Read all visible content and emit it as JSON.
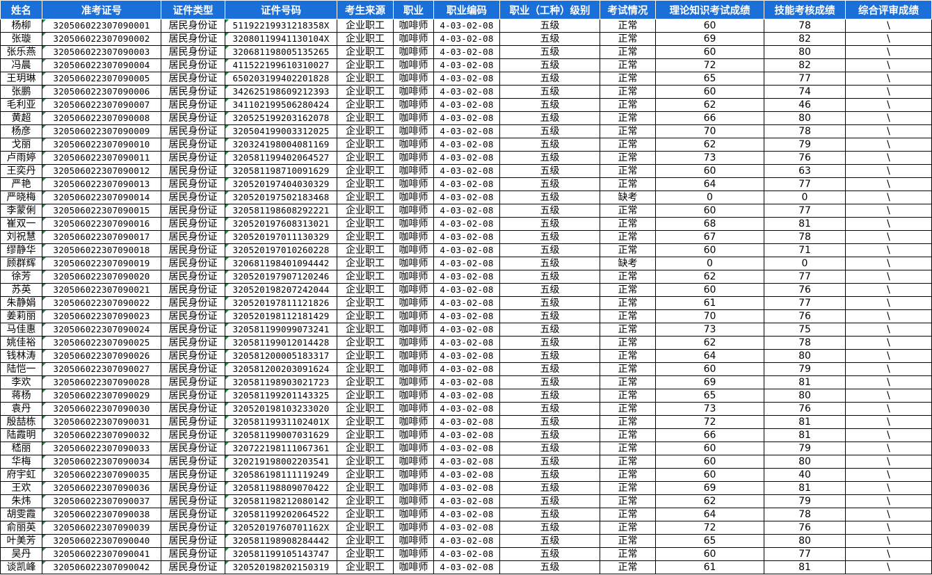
{
  "headers": [
    "姓名",
    "准考证号",
    "证件类型",
    "证件号码",
    "考生来源",
    "职业",
    "职业编码",
    "职业（工种）级别",
    "考试情况",
    "理论知识考试成绩",
    "技能考核成绩",
    "综合评审成绩"
  ],
  "rows": [
    [
      "杨柳",
      "320506022307090001",
      "居民身份证",
      "51192219931218358X",
      "企业职工",
      "咖啡师",
      "4-03-02-08",
      "五级",
      "正常",
      "60",
      "78",
      "\\"
    ],
    [
      "张璇",
      "320506022307090002",
      "居民身份证",
      "32080119941130104X",
      "企业职工",
      "咖啡师",
      "4-03-02-08",
      "五级",
      "正常",
      "69",
      "82",
      "\\"
    ],
    [
      "张乐燕",
      "320506022307090003",
      "居民身份证",
      "320681198005135265",
      "企业职工",
      "咖啡师",
      "4-03-02-08",
      "五级",
      "正常",
      "60",
      "80",
      "\\"
    ],
    [
      "冯晨",
      "320506022307090004",
      "居民身份证",
      "411522199610310027",
      "企业职工",
      "咖啡师",
      "4-03-02-08",
      "五级",
      "正常",
      "72",
      "82",
      "\\"
    ],
    [
      "王玥琳",
      "320506022307090005",
      "居民身份证",
      "650203199402201828",
      "企业职工",
      "咖啡师",
      "4-03-02-08",
      "五级",
      "正常",
      "65",
      "77",
      "\\"
    ],
    [
      "张鹏",
      "320506022307090006",
      "居民身份证",
      "342625198609212393",
      "企业职工",
      "咖啡师",
      "4-03-02-08",
      "五级",
      "正常",
      "60",
      "74",
      "\\"
    ],
    [
      "毛利亚",
      "320506022307090007",
      "居民身份证",
      "341102199506280424",
      "企业职工",
      "咖啡师",
      "4-03-02-08",
      "五级",
      "正常",
      "62",
      "46",
      "\\"
    ],
    [
      "黄超",
      "320506022307090008",
      "居民身份证",
      "320525199203162078",
      "企业职工",
      "咖啡师",
      "4-03-02-08",
      "五级",
      "正常",
      "66",
      "80",
      "\\"
    ],
    [
      "杨彦",
      "320506022307090009",
      "居民身份证",
      "320504199003312025",
      "企业职工",
      "咖啡师",
      "4-03-02-08",
      "五级",
      "正常",
      "70",
      "78",
      "\\"
    ],
    [
      "戈丽",
      "320506022307090010",
      "居民身份证",
      "320324198004081169",
      "企业职工",
      "咖啡师",
      "4-03-02-08",
      "五级",
      "正常",
      "62",
      "79",
      "\\"
    ],
    [
      "卢雨婷",
      "320506022307090011",
      "居民身份证",
      "320581199402064527",
      "企业职工",
      "咖啡师",
      "4-03-02-08",
      "五级",
      "正常",
      "73",
      "76",
      "\\"
    ],
    [
      "王奕丹",
      "320506022307090012",
      "居民身份证",
      "320581198710091629",
      "企业职工",
      "咖啡师",
      "4-03-02-08",
      "五级",
      "正常",
      "60",
      "63",
      "\\"
    ],
    [
      "严艳",
      "320506022307090013",
      "居民身份证",
      "320520197404030329",
      "企业职工",
      "咖啡师",
      "4-03-02-08",
      "五级",
      "正常",
      "64",
      "77",
      "\\"
    ],
    [
      "严晓梅",
      "320506022307090014",
      "居民身份证",
      "320520197502183468",
      "企业职工",
      "咖啡师",
      "4-03-02-08",
      "五级",
      "缺考",
      "0",
      "0",
      "\\"
    ],
    [
      "李蒙俐",
      "320506022307090015",
      "居民身份证",
      "320581198608292221",
      "企业职工",
      "咖啡师",
      "4-03-02-08",
      "五级",
      "正常",
      "60",
      "77",
      "\\"
    ],
    [
      "崔双一",
      "320506022307090016",
      "居民身份证",
      "320520197608313021",
      "企业职工",
      "咖啡师",
      "4-03-02-08",
      "五级",
      "正常",
      "68",
      "81",
      "\\"
    ],
    [
      "刘祝慧",
      "320506022307090017",
      "居民身份证",
      "320520197011130329",
      "企业职工",
      "咖啡师",
      "4-03-02-08",
      "五级",
      "正常",
      "67",
      "78",
      "\\"
    ],
    [
      "缪静华",
      "320506022307090018",
      "居民身份证",
      "320520197010260228",
      "企业职工",
      "咖啡师",
      "4-03-02-08",
      "五级",
      "正常",
      "60",
      "71",
      "\\"
    ],
    [
      "顾群辉",
      "320506022307090019",
      "居民身份证",
      "320681198401094442",
      "企业职工",
      "咖啡师",
      "4-03-02-08",
      "五级",
      "缺考",
      "0",
      "0",
      "\\"
    ],
    [
      "徐芳",
      "320506022307090020",
      "居民身份证",
      "320520197907120246",
      "企业职工",
      "咖啡师",
      "4-03-02-08",
      "五级",
      "正常",
      "62",
      "77",
      "\\"
    ],
    [
      "苏英",
      "320506022307090021",
      "居民身份证",
      "320520198207242044",
      "企业职工",
      "咖啡师",
      "4-03-02-08",
      "五级",
      "正常",
      "60",
      "76",
      "\\"
    ],
    [
      "朱静娟",
      "320506022307090022",
      "居民身份证",
      "320520197811121826",
      "企业职工",
      "咖啡师",
      "4-03-02-08",
      "五级",
      "正常",
      "61",
      "77",
      "\\"
    ],
    [
      "姜莉丽",
      "320506022307090023",
      "居民身份证",
      "320520198112181429",
      "企业职工",
      "咖啡师",
      "4-03-02-08",
      "五级",
      "正常",
      "70",
      "76",
      "\\"
    ],
    [
      "马佳惠",
      "320506022307090024",
      "居民身份证",
      "320581199099073241",
      "企业职工",
      "咖啡师",
      "4-03-02-08",
      "五级",
      "正常",
      "73",
      "75",
      "\\"
    ],
    [
      "姚佳裕",
      "320506022307090025",
      "居民身份证",
      "320581199012014428",
      "企业职工",
      "咖啡师",
      "4-03-02-08",
      "五级",
      "正常",
      "62",
      "78",
      "\\"
    ],
    [
      "钱林涛",
      "320506022307090026",
      "居民身份证",
      "320581200005183317",
      "企业职工",
      "咖啡师",
      "4-03-02-08",
      "五级",
      "正常",
      "64",
      "80",
      "\\"
    ],
    [
      "陆恺一",
      "320506022307090027",
      "居民身份证",
      "320581200203091624",
      "企业职工",
      "咖啡师",
      "4-03-02-08",
      "五级",
      "正常",
      "60",
      "79",
      "\\"
    ],
    [
      "李欢",
      "320506022307090028",
      "居民身份证",
      "320581198903021723",
      "企业职工",
      "咖啡师",
      "4-03-02-08",
      "五级",
      "正常",
      "69",
      "81",
      "\\"
    ],
    [
      "蒋杨",
      "320506022307090029",
      "居民身份证",
      "320581199201143325",
      "企业职工",
      "咖啡师",
      "4-03-02-08",
      "五级",
      "正常",
      "65",
      "80",
      "\\"
    ],
    [
      "袁丹",
      "320506022307090030",
      "居民身份证",
      "320520198103233020",
      "企业职工",
      "咖啡师",
      "4-03-02-08",
      "五级",
      "正常",
      "73",
      "76",
      "\\"
    ],
    [
      "殷喆栋",
      "320506022307090031",
      "居民身份证",
      "32058119931102401X",
      "企业职工",
      "咖啡师",
      "4-03-02-08",
      "五级",
      "正常",
      "72",
      "81",
      "\\"
    ],
    [
      "陆霞明",
      "320506022307090032",
      "居民身份证",
      "320581199007031629",
      "企业职工",
      "咖啡师",
      "4-03-02-08",
      "五级",
      "正常",
      "66",
      "81",
      "\\"
    ],
    [
      "嵇丽",
      "320506022307090033",
      "居民身份证",
      "320722198111067361",
      "企业职工",
      "咖啡师",
      "4-03-02-08",
      "五级",
      "正常",
      "60",
      "79",
      "\\"
    ],
    [
      "华梅",
      "320506022307090034",
      "居民身份证",
      "320219198002203541",
      "企业职工",
      "咖啡师",
      "4-03-02-08",
      "五级",
      "正常",
      "60",
      "80",
      "\\"
    ],
    [
      "府宇虹",
      "320506022307090035",
      "居民身份证",
      "320586198111119249",
      "企业职工",
      "咖啡师",
      "4-03-02-08",
      "五级",
      "正常",
      "60",
      "40",
      "\\"
    ],
    [
      "王欢",
      "320506022307090036",
      "居民身份证",
      "320581198809070422",
      "企业职工",
      "咖啡师",
      "4-03-02-08",
      "五级",
      "正常",
      "69",
      "81",
      "\\"
    ],
    [
      "朱炜",
      "320506022307090037",
      "居民身份证",
      "320581198212080142",
      "企业职工",
      "咖啡师",
      "4-03-02-08",
      "五级",
      "正常",
      "62",
      "79",
      "\\"
    ],
    [
      "胡雯霞",
      "320506022307090038",
      "居民身份证",
      "320581199202064522",
      "企业职工",
      "咖啡师",
      "4-03-02-08",
      "五级",
      "正常",
      "64",
      "78",
      "\\"
    ],
    [
      "俞丽英",
      "320506022307090039",
      "居民身份证",
      "32052019760701162X",
      "企业职工",
      "咖啡师",
      "4-03-02-08",
      "五级",
      "正常",
      "72",
      "76",
      "\\"
    ],
    [
      "叶美芳",
      "320506022307090040",
      "居民身份证",
      "320581198908284442",
      "企业职工",
      "咖啡师",
      "4-03-02-08",
      "五级",
      "正常",
      "65",
      "80",
      "\\"
    ],
    [
      "吴丹",
      "320506022307090041",
      "居民身份证",
      "320581199105143747",
      "企业职工",
      "咖啡师",
      "4-03-02-08",
      "五级",
      "正常",
      "60",
      "77",
      "\\"
    ],
    [
      "谈凯峰",
      "320506022307090042",
      "居民身份证",
      "320520198202150319",
      "企业职工",
      "咖啡师",
      "4-03-02-08",
      "五级",
      "正常",
      "61",
      "81",
      "\\"
    ]
  ]
}
